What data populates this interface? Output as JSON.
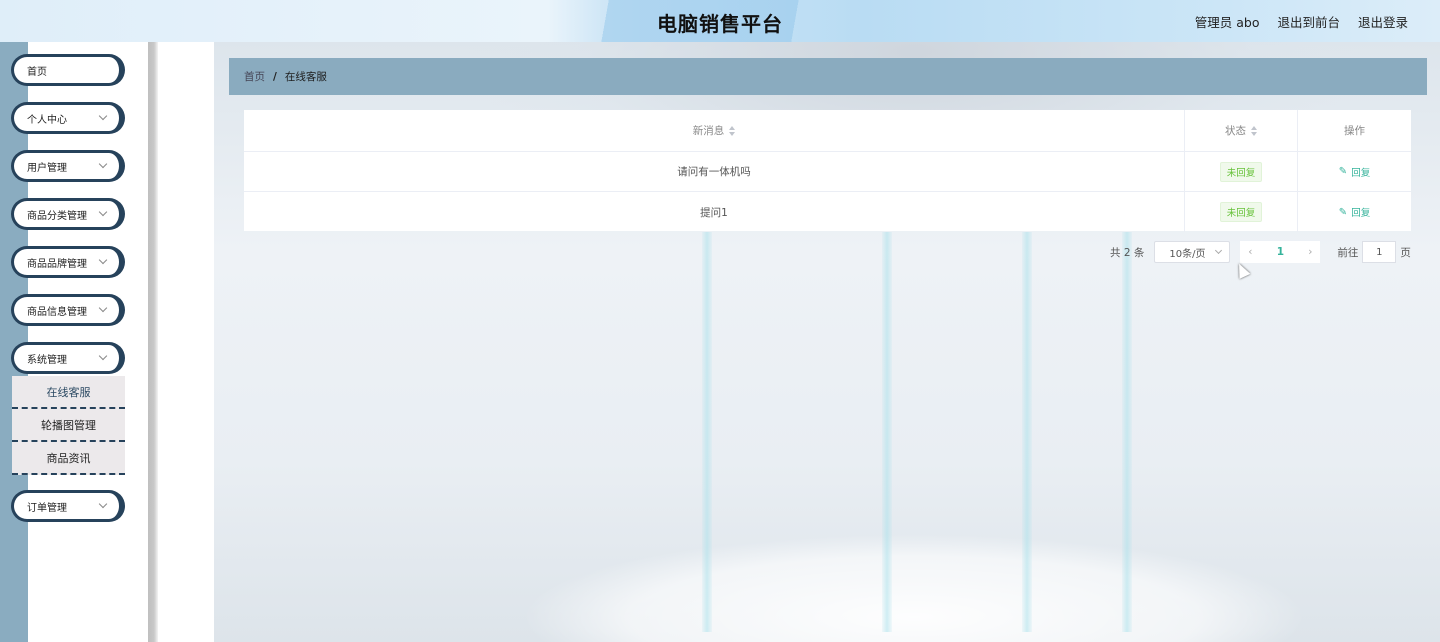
{
  "header": {
    "title": "电脑销售平台",
    "user": "管理员 abo",
    "front_link": "退出到前台",
    "logout_link": "退出登录"
  },
  "sidebar": {
    "items": [
      {
        "label": "首页"
      },
      {
        "label": "个人中心"
      },
      {
        "label": "用户管理"
      },
      {
        "label": "商品分类管理"
      },
      {
        "label": "商品品牌管理"
      },
      {
        "label": "商品信息管理"
      },
      {
        "label": "系统管理"
      },
      {
        "label": "订单管理"
      }
    ],
    "submenu": [
      {
        "label": "在线客服",
        "active": true
      },
      {
        "label": "轮播图管理"
      },
      {
        "label": "商品资讯"
      }
    ]
  },
  "breadcrumb": {
    "home": "首页",
    "separator": "/",
    "current": "在线客服"
  },
  "table": {
    "columns": [
      "新消息",
      "状态",
      "操作"
    ],
    "rows": [
      {
        "message": "请问有一体机吗",
        "status": "未回复",
        "action": "回复"
      },
      {
        "message": "提问1",
        "status": "未回复",
        "action": "回复"
      }
    ]
  },
  "pagination": {
    "total": "共 2 条",
    "page_size": "10条/页",
    "current_page": "1",
    "goto_label": "前往",
    "goto_value": "1",
    "page_suffix": "页"
  },
  "colors": {
    "sidebar_border": "#26425b",
    "breadcrumb_bg": "#8aabbf",
    "accent": "#35b39b",
    "tag_green": "#67c23a"
  }
}
